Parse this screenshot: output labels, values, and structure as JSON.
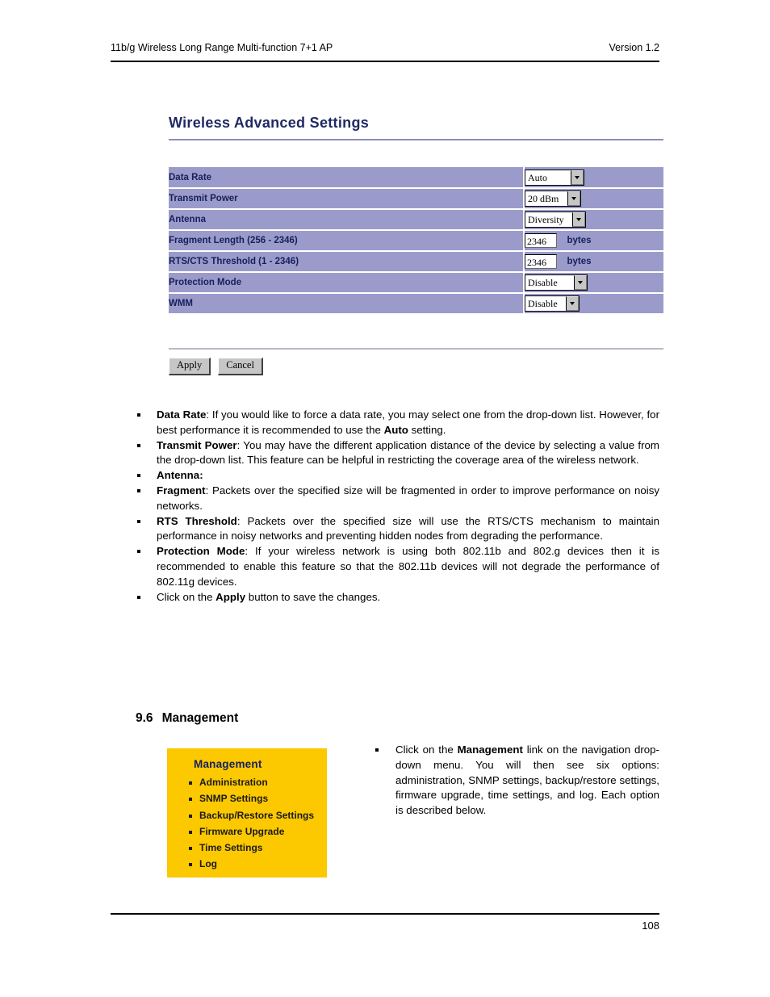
{
  "header": {
    "left": "11b/g Wireless Long Range Multi-function 7+1 AP",
    "right": "Version 1.2"
  },
  "footer": {
    "page_number": "108"
  },
  "panel": {
    "title": "Wireless Advanced Settings",
    "rows": [
      {
        "label": "Data Rate",
        "control": "select",
        "value": "Auto"
      },
      {
        "label": "Transmit Power",
        "control": "select",
        "value": "20 dBm"
      },
      {
        "label": "Antenna",
        "control": "select",
        "value": "Diversity"
      },
      {
        "label": "Fragment Length (256 - 2346)",
        "control": "text",
        "value": "2346",
        "unit": "bytes"
      },
      {
        "label": "RTS/CTS Threshold (1 - 2346)",
        "control": "text",
        "value": "2346",
        "unit": "bytes"
      },
      {
        "label": "Protection Mode",
        "control": "select",
        "value": "Disable"
      },
      {
        "label": "WMM",
        "control": "select",
        "value": "Disable"
      }
    ],
    "buttons": {
      "apply": "Apply",
      "cancel": "Cancel"
    }
  },
  "bullets": [
    {
      "term": "Data Rate",
      "text_before": "",
      "text": ": If you would like to force a data rate, you may select one from the drop-down list. However, for best performance it is recommended to use the ",
      "emphasis": "Auto",
      "text_after": " setting."
    },
    {
      "term": "Transmit Power",
      "text": ": You may have the different application distance of the device by selecting a value from the drop-down list. This feature can be helpful in restricting the coverage area of the wireless network."
    },
    {
      "term": "Antenna:",
      "text": ""
    },
    {
      "term": "Fragment",
      "text": ": Packets over the specified size will be fragmented in order to improve performance on noisy networks."
    },
    {
      "term": "RTS Threshold",
      "text": ": Packets over the specified size will use the RTS/CTS mechanism to maintain performance in noisy networks and preventing hidden nodes from degrading the performance."
    },
    {
      "term": "Protection Mode",
      "text": ": If your wireless network is using both 802.11b and 802.g devices then it is recommended to enable this feature so that the 802.11b devices will not degrade the performance of 802.11g devices."
    },
    {
      "lead": "Click on the ",
      "emphasis": "Apply",
      "text_after": " button to save the changes."
    }
  ],
  "section": {
    "number": "9.6",
    "title": "Management"
  },
  "management_menu": {
    "title": "Management",
    "items": [
      "Administration",
      "SNMP Settings",
      "Backup/Restore Settings",
      "Firmware Upgrade",
      "Time Settings",
      "Log"
    ]
  },
  "management_note": {
    "lead": "Click on the ",
    "emphasis": "Management",
    "text_after": " link on the navigation drop-down menu. You will then see six options: administration, SNMP settings, backup/restore settings, firmware upgrade, time settings, and log. Each option is described below."
  }
}
